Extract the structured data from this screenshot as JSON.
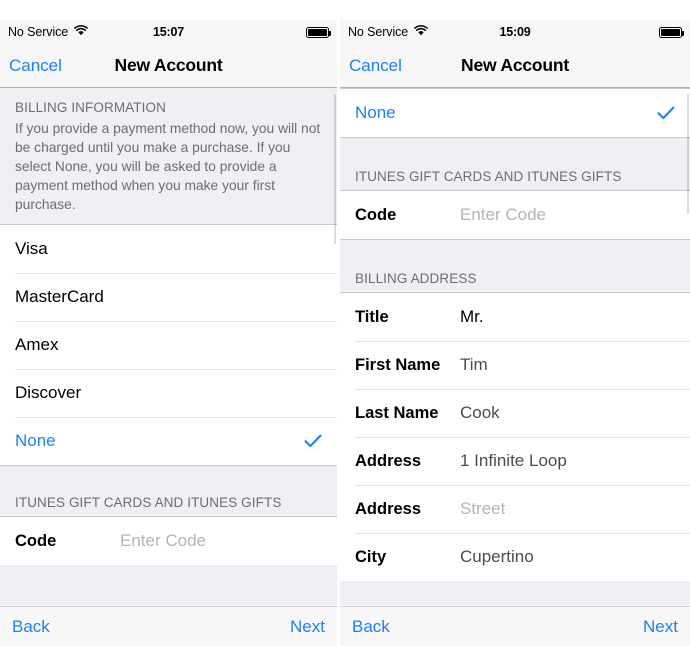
{
  "left_panel": {
    "status_bar": {
      "carrier": "No Service",
      "time": "15:07",
      "wifi_icon": "wifi-icon",
      "battery_icon": "battery-full-icon"
    },
    "nav": {
      "cancel_label": "Cancel",
      "title": "New Account"
    },
    "billing_section": {
      "header": "BILLING INFORMATION",
      "blurb": "If you provide a payment method now, you will not be charged until you make a purchase. If you select None, you will be asked to provide a payment method when you make your first purchase."
    },
    "payment_methods": [
      {
        "label": "Visa",
        "selected": false
      },
      {
        "label": "MasterCard",
        "selected": false
      },
      {
        "label": "Amex",
        "selected": false
      },
      {
        "label": "Discover",
        "selected": false
      },
      {
        "label": "None",
        "selected": true
      }
    ],
    "gift_section": {
      "header": "ITUNES GIFT CARDS AND ITUNES GIFTS",
      "code_label": "Code",
      "code_placeholder": "Enter Code"
    },
    "toolbar": {
      "back_label": "Back",
      "next_label": "Next"
    }
  },
  "right_panel": {
    "status_bar": {
      "carrier": "No Service",
      "time": "15:09",
      "wifi_icon": "wifi-icon",
      "battery_icon": "battery-full-icon"
    },
    "nav": {
      "cancel_label": "Cancel",
      "title": "New Account"
    },
    "none_row": {
      "label": "None",
      "selected": true
    },
    "gift_section": {
      "header": "ITUNES GIFT CARDS AND ITUNES GIFTS",
      "code_label": "Code",
      "code_placeholder": "Enter Code"
    },
    "billing_address": {
      "header": "BILLING ADDRESS",
      "fields": [
        {
          "label": "Title",
          "value": "Mr.",
          "is_placeholder": false
        },
        {
          "label": "First Name",
          "value": "Tim",
          "is_placeholder": false
        },
        {
          "label": "Last Name",
          "value": "Cook",
          "is_placeholder": false
        },
        {
          "label": "Address",
          "value": "1 Infinite Loop",
          "is_placeholder": false
        },
        {
          "label": "Address",
          "value": "Street",
          "is_placeholder": true
        },
        {
          "label": "City",
          "value": "Cupertino",
          "is_placeholder": false
        }
      ]
    },
    "toolbar": {
      "back_label": "Back",
      "next_label": "Next"
    }
  },
  "colors": {
    "accent_blue": "#1a82f7",
    "group_bg": "#eff0f3",
    "row_bg": "#ffffff",
    "caption_grey": "#6d6d72",
    "placeholder_grey": "#b4b4b8",
    "separator": "#c8c7cc",
    "chrome_bg": "#f7f7f7"
  }
}
